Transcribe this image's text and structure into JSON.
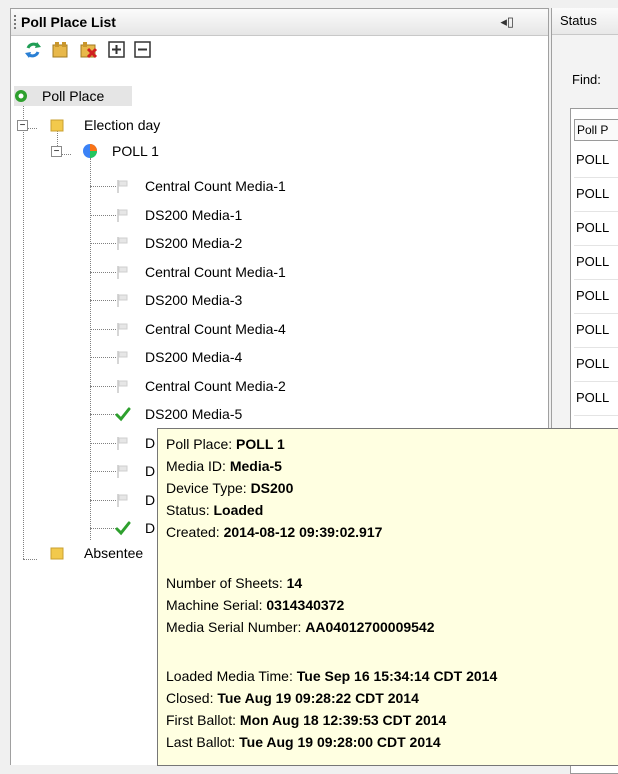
{
  "panel": {
    "title": "Poll Place List",
    "pin_icon": "pin-icon"
  },
  "toolbar": {
    "buttons": [
      {
        "name": "refresh-icon"
      },
      {
        "name": "load-media-icon"
      },
      {
        "name": "unload-media-icon"
      },
      {
        "name": "expand-all-icon"
      },
      {
        "name": "collapse-all-icon"
      }
    ]
  },
  "tree": {
    "root": "Poll Place",
    "election_day": "Election day",
    "poll": "POLL 1",
    "media": [
      {
        "label": "Central Count Media-1",
        "status": "flag"
      },
      {
        "label": "DS200 Media-1",
        "status": "flag"
      },
      {
        "label": "DS200 Media-2",
        "status": "flag"
      },
      {
        "label": "Central Count Media-1",
        "status": "flag"
      },
      {
        "label": "DS200 Media-3",
        "status": "flag"
      },
      {
        "label": "Central Count Media-4",
        "status": "flag"
      },
      {
        "label": "DS200 Media-4",
        "status": "flag"
      },
      {
        "label": "Central Count Media-2",
        "status": "flag"
      },
      {
        "label": "DS200 Media-5",
        "status": "check"
      },
      {
        "label": "D",
        "status": "flag"
      },
      {
        "label": "D",
        "status": "flag"
      },
      {
        "label": "D",
        "status": "flag"
      },
      {
        "label": "D",
        "status": "check"
      }
    ],
    "absentee": "Absentee"
  },
  "right": {
    "tab": "Status",
    "find_label": "Find:",
    "column": "Poll P",
    "rows": [
      "POLL",
      "POLL",
      "POLL",
      "POLL",
      "POLL",
      "POLL",
      "POLL",
      "POLL"
    ]
  },
  "tooltip": {
    "poll_place_label": "Poll Place: ",
    "poll_place": "POLL 1",
    "media_id_label": "Media ID: ",
    "media_id": "Media-5",
    "device_type_label": "Device Type: ",
    "device_type": "DS200",
    "status_label": "Status: ",
    "status": "Loaded",
    "created_label": "Created: ",
    "created": "2014-08-12 09:39:02.917",
    "sheets_label": "Number of Sheets: ",
    "sheets": "14",
    "machine_serial_label": "Machine Serial: ",
    "machine_serial": "0314340372",
    "media_serial_label": "Media Serial Number: ",
    "media_serial": "AA04012700009542",
    "loaded_time_label": "Loaded Media Time: ",
    "loaded_time": "Tue Sep 16 15:34:14 CDT 2014",
    "closed_label": "Closed: ",
    "closed": "Tue Aug 19 09:28:22 CDT 2014",
    "first_ballot_label": "First Ballot: ",
    "first_ballot": "Mon Aug 18 12:39:53 CDT 2014",
    "last_ballot_label": "Last Ballot: ",
    "last_ballot": "Tue Aug 19 09:28:00 CDT 2014"
  },
  "colors": {
    "folder": "#f2c94c",
    "check": "#2ea02e",
    "refresh": "#1f9d55"
  }
}
